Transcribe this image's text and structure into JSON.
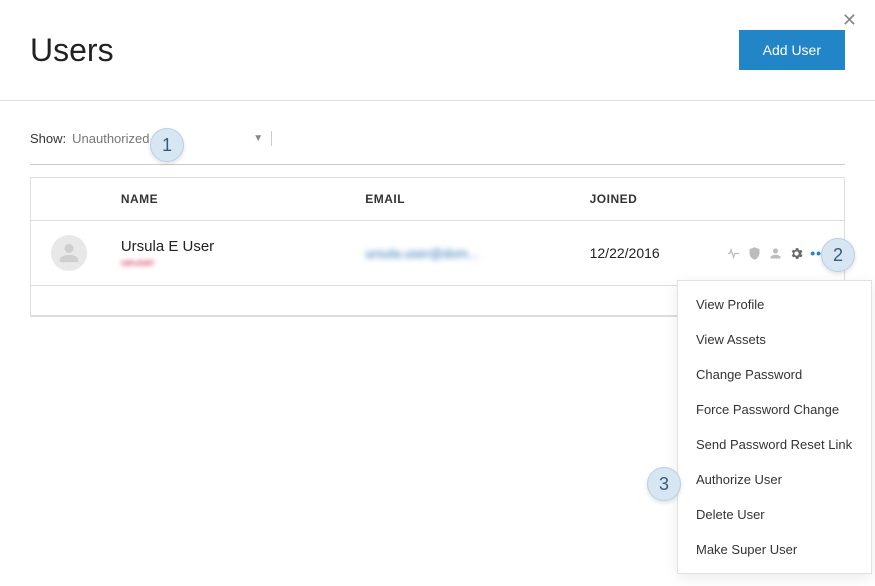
{
  "header": {
    "title": "Users",
    "add_button": "Add User"
  },
  "filter": {
    "show_label": "Show:",
    "selected": "Unauthorized"
  },
  "columns": {
    "name": "NAME",
    "email": "EMAIL",
    "joined": "JOINED"
  },
  "row": {
    "name": "Ursula E User",
    "name_sub": "ueuser",
    "email_obscured": "ursula.user@dom...",
    "joined": "12/22/2016"
  },
  "menu": {
    "items": [
      "View Profile",
      "View Assets",
      "Change Password",
      "Force Password Change",
      "Send Password Reset Link",
      "Authorize User",
      "Delete User",
      "Make Super User"
    ]
  },
  "callouts": {
    "c1": "1",
    "c2": "2",
    "c3": "3"
  }
}
